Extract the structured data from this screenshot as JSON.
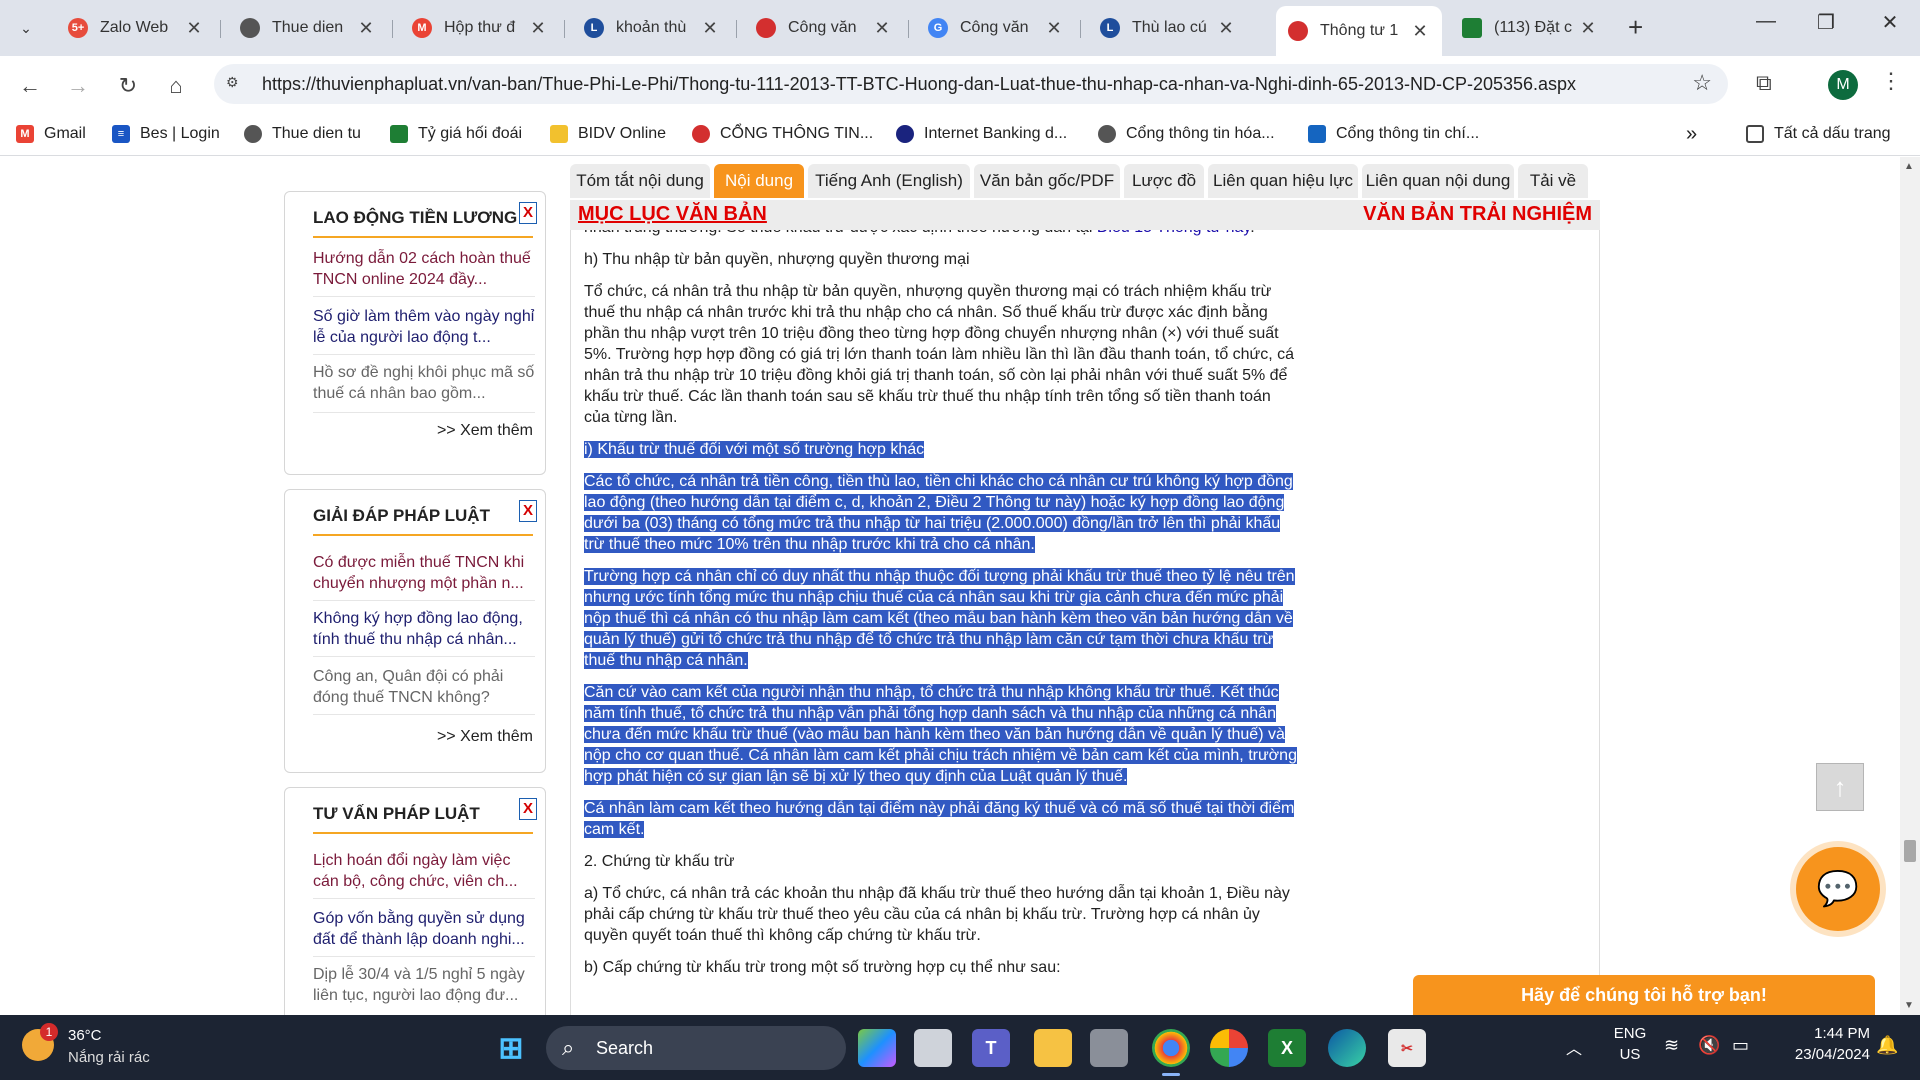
{
  "browser": {
    "tabs": [
      {
        "title": "Zalo Web",
        "icon_color": "#e74c3c",
        "icon_text": "5+"
      },
      {
        "title": "Thue dien",
        "icon_color": "#555555",
        "icon_text": ""
      },
      {
        "title": "Hộp thư đ",
        "icon_color": "#ea4335",
        "icon_text": "M"
      },
      {
        "title": "khoản thù",
        "icon_color": "#1f4e9c",
        "icon_text": "L"
      },
      {
        "title": "Công văn",
        "icon_color": "#d32f2f",
        "icon_text": ""
      },
      {
        "title": "Công văn",
        "icon_color": "#4285f4",
        "icon_text": "G"
      },
      {
        "title": "Thù lao cú",
        "icon_color": "#1f4e9c",
        "icon_text": "L"
      },
      {
        "title": "Thông tư 1",
        "icon_color": "#d32f2f",
        "icon_text": ""
      },
      {
        "title": "(113) Đặt c",
        "icon_color": "#1e7e34",
        "icon_text": ""
      }
    ],
    "url": "https://thuvienphapluat.vn/van-ban/Thue-Phi-Le-Phi/Thong-tu-111-2013-TT-BTC-Huong-dan-Luat-thue-thu-nhap-ca-nhan-va-Nghi-dinh-65-2013-ND-CP-205356.aspx",
    "profile_initial": "M",
    "bookmarks": [
      {
        "label": "Gmail",
        "icon_color": "#ea4335",
        "icon_text": "M"
      },
      {
        "label": "Bes | Login",
        "icon_color": "#1a56c4",
        "icon_text": "≡"
      },
      {
        "label": "Thue dien tu",
        "icon_color": "#555555",
        "icon_text": ""
      },
      {
        "label": "Tỷ giá hối đoái",
        "icon_color": "#1e7e34",
        "icon_text": ""
      },
      {
        "label": "BIDV Online",
        "icon_color": "#f2c12e",
        "icon_text": ""
      },
      {
        "label": "CỔNG THÔNG TIN...",
        "icon_color": "#d32f2f",
        "icon_text": ""
      },
      {
        "label": "Internet Banking d...",
        "icon_color": "#1a237e",
        "icon_text": ""
      },
      {
        "label": "Cổng thông tin hóa...",
        "icon_color": "#555555",
        "icon_text": ""
      },
      {
        "label": "Cổng thông tin chí...",
        "icon_color": "#1565c0",
        "icon_text": ""
      }
    ],
    "all_bookmarks": "Tất cả dấu trang"
  },
  "sidebar": {
    "boxes": [
      {
        "title": "LAO ĐỘNG TIỀN LƯƠNG",
        "close": "X",
        "items": [
          "Hướng dẫn 02 cách hoàn thuế TNCN online 2024 đầy...",
          "Số giờ làm thêm vào ngày nghỉ lễ của người lao động t...",
          "Hồ sơ đề nghị khôi phục mã số thuế cá nhân bao gồm..."
        ],
        "more": ">> Xem thêm"
      },
      {
        "title": "GIẢI ĐÁP PHÁP LUẬT",
        "close": "X",
        "items": [
          "Có được miễn thuế TNCN khi chuyển nhượng một phần n...",
          "Không ký hợp đồng lao động, tính thuế thu nhập cá nhân...",
          "Công an, Quân đội có phải đóng thuế TNCN không?"
        ],
        "more": ">> Xem thêm"
      },
      {
        "title": "TƯ VẤN PHÁP LUẬT",
        "close": "X",
        "items": [
          "Lịch hoán đổi ngày làm việc cán bộ, công chức, viên ch...",
          "Góp vốn bằng quyền sử dụng đất để thành lập doanh nghi...",
          "Dịp lễ 30/4 và 1/5 nghỉ 5 ngày liên tục, người lao động đư..."
        ]
      }
    ]
  },
  "doc_tabs": [
    "Tóm tắt nội dung",
    "Nội dung",
    "Tiếng Anh (English)",
    "Văn bản gốc/PDF",
    "Lược đồ",
    "Liên quan hiệu lực",
    "Liên quan nội dung",
    "Tải về"
  ],
  "doc_header": {
    "left": "MỤC LỤC VĂN BẢN",
    "right": "VĂN BẢN TRẢI NGHIỆM"
  },
  "document": {
    "p0_text": "nhân trúng thưởng. Số thuế khấu trừ được xác định theo hướng dẫn tại ",
    "p0_link": "Điều 15 Thông tư này",
    "p0_end": ".",
    "p1": "h) Thu nhập từ bản quyền, nhượng quyền thương mại",
    "p2": "Tổ chức, cá nhân trả thu nhập từ bản quyền, nhượng quyền thương mại có trách nhiệm khấu trừ thuế thu nhập cá nhân trước khi trả thu nhập cho cá nhân. Số thuế khấu trừ được xác định bằng phần thu nhập vượt trên 10 triệu đồng theo từng hợp đồng chuyển nhượng nhân (×) với thuế suất 5%. Trường hợp hợp đồng có giá trị lớn thanh toán làm nhiều lần thì lần đầu thanh toán, tổ chức, cá nhân trả thu nhập trừ 10 triệu đồng khỏi giá trị thanh toán, số còn lại phải nhân với thuế suất 5% để khấu trừ thuế. Các lần thanh toán sau sẽ khấu trừ thuế thu nhập tính trên tổng số tiền thanh toán của từng lần.",
    "p3": "i) Khấu trừ thuế đối với một số trường hợp khác",
    "p4": "Các tổ chức, cá nhân trả tiền công, tiền thù lao, tiền chi khác cho cá nhân cư trú không ký hợp đồng lao động (theo hướng dẫn tại điểm c, d, khoản 2, Điều 2 Thông tư này) hoặc ký hợp đồng lao động dưới ba (03) tháng có tổng mức trả thu nhập từ hai triệu (2.000.000) đồng/lần trở lên thì phải khấu trừ thuế theo mức 10% trên thu nhập trước khi trả cho cá nhân.",
    "p5": "Trường hợp cá nhân chỉ có duy nhất thu nhập thuộc đối tượng phải khấu trừ thuế theo tỷ lệ nêu trên nhưng ước tính tổng mức thu nhập chịu thuế của cá nhân sau khi trừ gia cảnh chưa đến mức phải nộp thuế thì cá nhân có thu nhập làm cam kết (theo mẫu ban hành kèm theo văn bản hướng dẫn về quản lý thuế) gửi tổ chức trả thu nhập để tổ chức trả thu nhập làm căn cứ tạm thời chưa khấu trừ thuế thu nhập cá nhân.",
    "p6": "Căn cứ vào cam kết của người nhận thu nhập, tổ chức trả thu nhập không khấu trừ thuế. Kết thúc năm tính thuế, tổ chức trả thu nhập vẫn phải tổng hợp danh sách và thu nhập của những cá nhân chưa đến mức khấu trừ thuế (vào mẫu ban hành kèm theo văn bản hướng dẫn về quản lý thuế) và nộp cho cơ quan thuế. Cá nhân làm cam kết phải chịu trách nhiệm về bản cam kết của mình, trường hợp phát hiện có sự gian lận sẽ bị xử lý theo quy định của Luật quản lý thuế.",
    "p7": "Cá nhân làm cam kết theo hướng dẫn tại điểm này phải đăng ký thuế và có mã số thuế tại thời điểm cam kết.",
    "p8": "2. Chứng từ khấu trừ",
    "p9": "a) Tổ chức, cá nhân trả các khoản thu nhập đã khấu trừ thuế theo hướng dẫn tại khoản 1, Điều này phải cấp chứng từ khấu trừ thuế theo yêu cầu của cá nhân bị khấu trừ. Trường hợp cá nhân ủy quyền quyết toán thuế thì không cấp chứng từ khấu trừ.",
    "p10": "b) Cấp chứng từ khấu trừ trong một số trường hợp cụ thể như sau:"
  },
  "support_text": "Hãy để chúng tôi hỗ trợ bạn!",
  "taskbar": {
    "weather_badge": "1",
    "temperature": "36°C",
    "weather": "Nắng rải rác",
    "search_label": "Search",
    "lang_top": "ENG",
    "lang_bottom": "US",
    "time": "1:44 PM",
    "date": "23/04/2024"
  }
}
